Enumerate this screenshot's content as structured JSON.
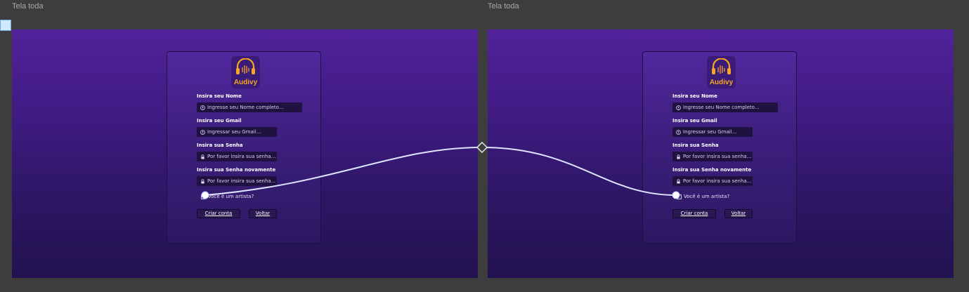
{
  "frames": [
    {
      "title": "Tela toda",
      "logo_text": "Audivy",
      "fields": [
        {
          "label": "Insira seu Nome",
          "placeholder": "Ingresse seu Nome completo...",
          "icon": "user-circle-icon"
        },
        {
          "label": "Insira seu Gmail",
          "placeholder": "Ingressar seu Gmail...",
          "icon": "user-circle-icon"
        },
        {
          "label": "Insira sua Senha",
          "placeholder": "Por favor insira sua senha...",
          "icon": "lock-icon"
        },
        {
          "label": "Insira sua Senha novamente",
          "placeholder": "Por favor insira sua senha...",
          "icon": "lock-icon"
        }
      ],
      "checkbox_label": "Você é um artista?",
      "buttons": {
        "create": "Criar conta",
        "back": "Voltar"
      }
    },
    {
      "title": "Tela toda",
      "logo_text": "Audivy",
      "fields": [
        {
          "label": "Insira seu Nome",
          "placeholder": "Ingresse seu Nome completo...",
          "icon": "user-circle-icon"
        },
        {
          "label": "Insira seu Gmail",
          "placeholder": "Ingressar seu Gmail...",
          "icon": "user-circle-icon"
        },
        {
          "label": "Insira sua Senha",
          "placeholder": "Por favor insira sua senha...",
          "icon": "lock-icon"
        },
        {
          "label": "Insira sua Senha novamente",
          "placeholder": "Por favor insira sua senha...",
          "icon": "lock-icon"
        }
      ],
      "checkbox_label": "Você é um artista?",
      "buttons": {
        "create": "Criar conta",
        "back": "Voltar"
      }
    }
  ],
  "colors": {
    "canvas": "#3d3d3d",
    "accent_logo": "#f5a623",
    "connector": "#dde4ff"
  }
}
